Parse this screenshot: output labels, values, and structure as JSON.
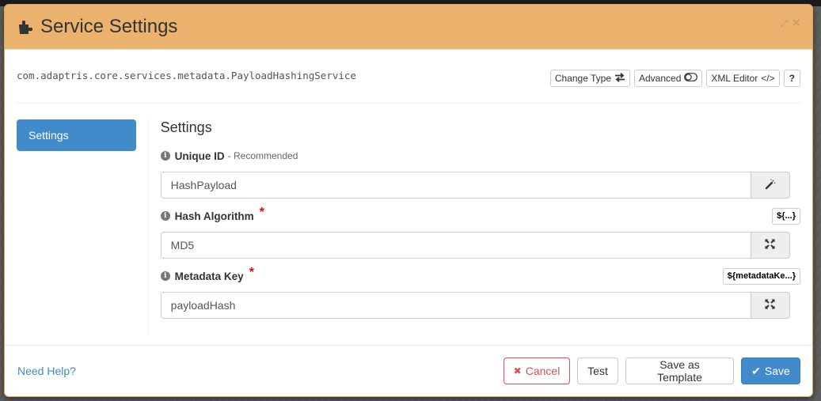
{
  "modal": {
    "title": "Service Settings",
    "title_icon": "puzzle-piece-icon",
    "header_controls": [
      {
        "name": "expand-icon",
        "glyph": "⤢"
      },
      {
        "name": "close-icon",
        "glyph": "✕"
      }
    ]
  },
  "class_name": "com.adaptris.core.services.metadata.PayloadHashingService",
  "toolbar": {
    "change_type": "Change Type",
    "change_type_icon": "⇄",
    "advanced": "Advanced",
    "advanced_icon": "toggle-icon",
    "xml_editor": "XML Editor",
    "xml_editor_icon": "</>",
    "help": "?"
  },
  "sidebar": {
    "items": [
      {
        "label": "Settings",
        "active": true
      }
    ]
  },
  "content": {
    "section_title": "Settings",
    "fields": [
      {
        "label": "Unique ID",
        "hint": "- Recommended",
        "required": false,
        "value": "HashPayload",
        "addon_icon": "magic-wand-icon",
        "expression_button": null
      },
      {
        "label": "Hash Algorithm",
        "hint": "",
        "required": true,
        "value": "MD5",
        "addon_icon": "expand-arrows-icon",
        "expression_button": "${...}"
      },
      {
        "label": "Metadata Key",
        "hint": "",
        "required": true,
        "value": "payloadHash",
        "addon_icon": "expand-arrows-icon",
        "expression_button": "${metadataKe...}"
      }
    ],
    "required_marker": "*",
    "info_glyph": "i"
  },
  "footer": {
    "help_link": "Need Help?",
    "cancel": "Cancel",
    "cancel_icon": "✖",
    "test": "Test",
    "save_as_template": "Save as Template",
    "save": "Save",
    "save_icon": "✔"
  },
  "colors": {
    "header_bg": "#eab26d",
    "primary": "#428bca",
    "danger": "#d9534f",
    "required": "#ee0000"
  }
}
